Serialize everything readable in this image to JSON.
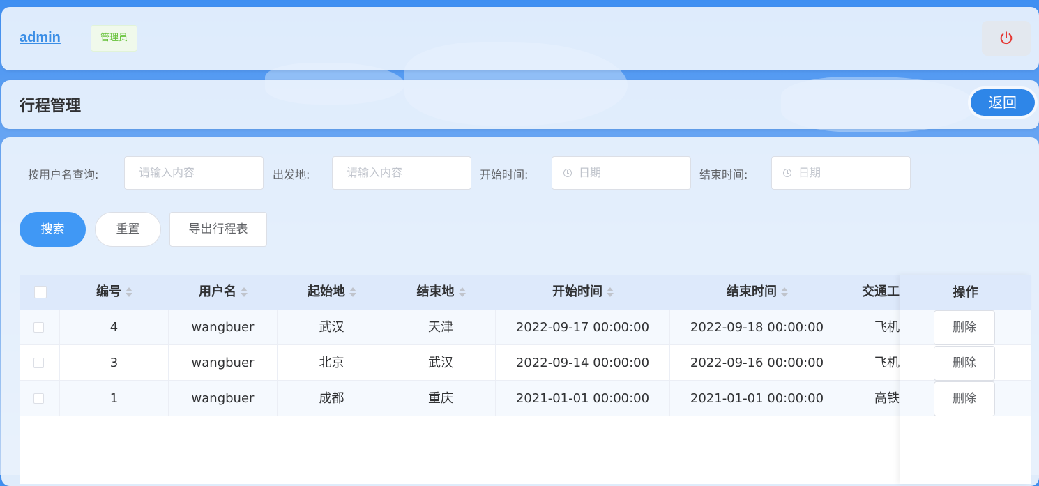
{
  "header": {
    "username": "admin",
    "role": "管理员"
  },
  "titlebar": {
    "title": "行程管理",
    "back_label": "返回"
  },
  "filters": {
    "username_label": "按用户名查询:",
    "username_placeholder": "请输入内容",
    "departure_label": "出发地:",
    "departure_placeholder": "请输入内容",
    "start_label": "开始时间:",
    "start_placeholder": "日期",
    "end_label": "结束时间:",
    "end_placeholder": "日期"
  },
  "actions": {
    "search_label": "搜索",
    "reset_label": "重置",
    "export_label": "导出行程表"
  },
  "table": {
    "headers": {
      "id": "编号",
      "username": "用户名",
      "from": "起始地",
      "to": "结束地",
      "start": "开始时间",
      "end": "结束时间",
      "transport": "交通工",
      "ops": "操作"
    },
    "delete_label": "删除",
    "rows": [
      {
        "id": "4",
        "username": "wangbuer",
        "from": "武汉",
        "to": "天津",
        "start": "2022-09-17 00:00:00",
        "end": "2022-09-18 00:00:00",
        "transport": "飞机"
      },
      {
        "id": "3",
        "username": "wangbuer",
        "from": "北京",
        "to": "武汉",
        "start": "2022-09-14 00:00:00",
        "end": "2022-09-16 00:00:00",
        "transport": "飞机"
      },
      {
        "id": "1",
        "username": "wangbuer",
        "from": "成都",
        "to": "重庆",
        "start": "2021-01-01 00:00:00",
        "end": "2021-01-01 00:00:00",
        "transport": "高铁"
      }
    ]
  },
  "colors": {
    "primary": "#4098f5",
    "tag_green": "#67c23a",
    "logout_red": "#e53935"
  },
  "icons": {
    "logout": "power-icon",
    "date": "clock-icon"
  }
}
